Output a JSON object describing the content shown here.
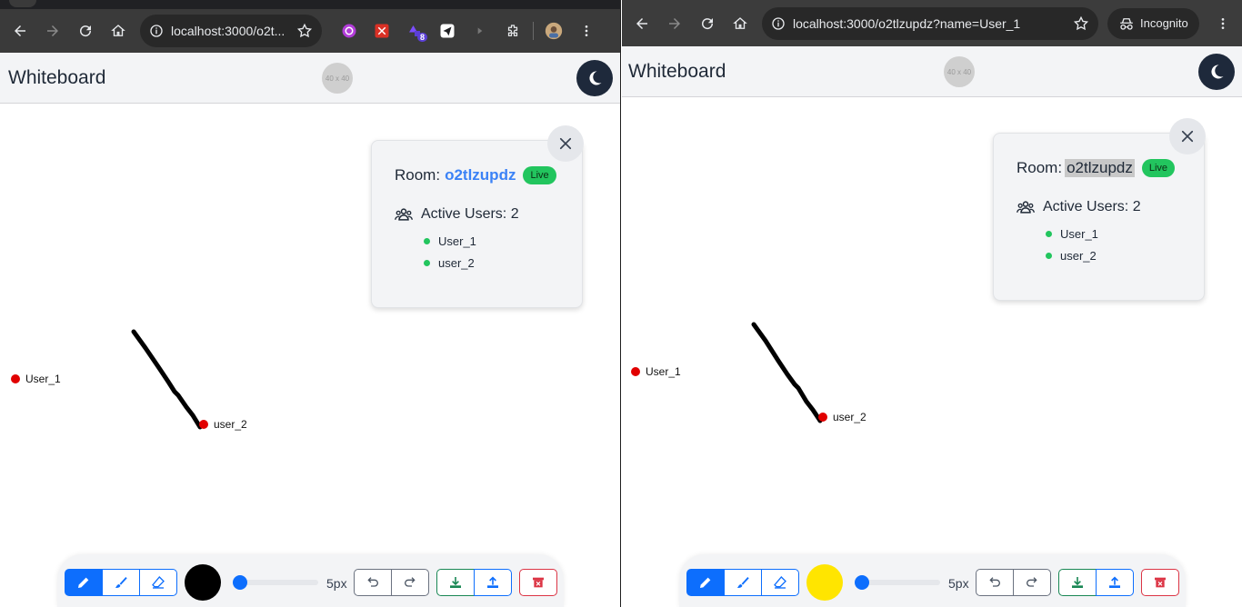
{
  "left_window": {
    "browser": {
      "url": "localhost:3000/o2t...",
      "ext_badge": "8"
    },
    "app": {
      "title": "Whiteboard",
      "placeholder_text": "40 x 40"
    },
    "room": {
      "label": "Room:",
      "id": "o2tlzupdz",
      "status": "Live",
      "active_users_label": "Active Users: 2",
      "users": [
        "User_1",
        "user_2"
      ]
    },
    "cursors": {
      "user_1": "User_1",
      "user_2": "user_2"
    },
    "toolbar": {
      "color": "#000000",
      "brush_size": 5,
      "size_label": "5px"
    }
  },
  "right_window": {
    "browser": {
      "url": "localhost:3000/o2tlzupdz?name=User_1",
      "incognito_label": "Incognito"
    },
    "app": {
      "title": "Whiteboard",
      "placeholder_text": "40 x 40"
    },
    "room": {
      "label": "Room:",
      "id": "o2tlzupdz",
      "status": "Live",
      "active_users_label": "Active Users: 2",
      "users": [
        "User_1",
        "user_2"
      ]
    },
    "cursors": {
      "user_1": "User_1",
      "user_2": "user_2"
    },
    "toolbar": {
      "color": "#ffe500",
      "brush_size": 5,
      "size_label": "5px"
    }
  },
  "colors": {
    "primary": "#0d6efd",
    "success": "#198754",
    "danger": "#dc3545",
    "live": "#22c55e",
    "cursor": "#e10000"
  }
}
